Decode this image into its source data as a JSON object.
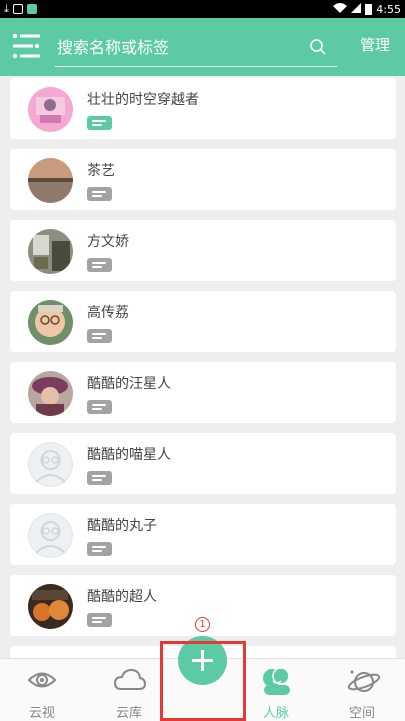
{
  "status_bar": {
    "time": "4:55"
  },
  "search": {
    "placeholder": "搜索名称或标签"
  },
  "header": {
    "manage_label": "管理"
  },
  "colors": {
    "accent": "#5ccba4",
    "tag_gray": "#a3a3a3",
    "highlight": "#e53935"
  },
  "contacts": [
    {
      "name": "壮壮的时空穿越者",
      "tag_active": true,
      "avatar": "pink-photo-avatar"
    },
    {
      "name": "茶艺",
      "tag_active": false,
      "avatar": "sunset-photo-avatar"
    },
    {
      "name": "方文娇",
      "tag_active": false,
      "avatar": "room-photo-avatar"
    },
    {
      "name": "高传荔",
      "tag_active": false,
      "avatar": "baby-photo-avatar"
    },
    {
      "name": "酷酷的汪星人",
      "tag_active": false,
      "avatar": "hat-photo-avatar"
    },
    {
      "name": "酷酷的喵星人",
      "tag_active": false,
      "avatar": "default-avatar"
    },
    {
      "name": "酷酷的丸子",
      "tag_active": false,
      "avatar": "default-avatar"
    },
    {
      "name": "酷酷的超人",
      "tag_active": false,
      "avatar": "pumpkin-photo-avatar"
    }
  ],
  "nav": {
    "items": [
      {
        "label": "云视",
        "icon": "eye-icon"
      },
      {
        "label": "云库",
        "icon": "cloud-icon"
      },
      {
        "label": "人脉",
        "icon": "people-icon",
        "active": true
      },
      {
        "label": "空间",
        "icon": "planet-icon"
      }
    ]
  },
  "annotation": {
    "number": "1"
  }
}
